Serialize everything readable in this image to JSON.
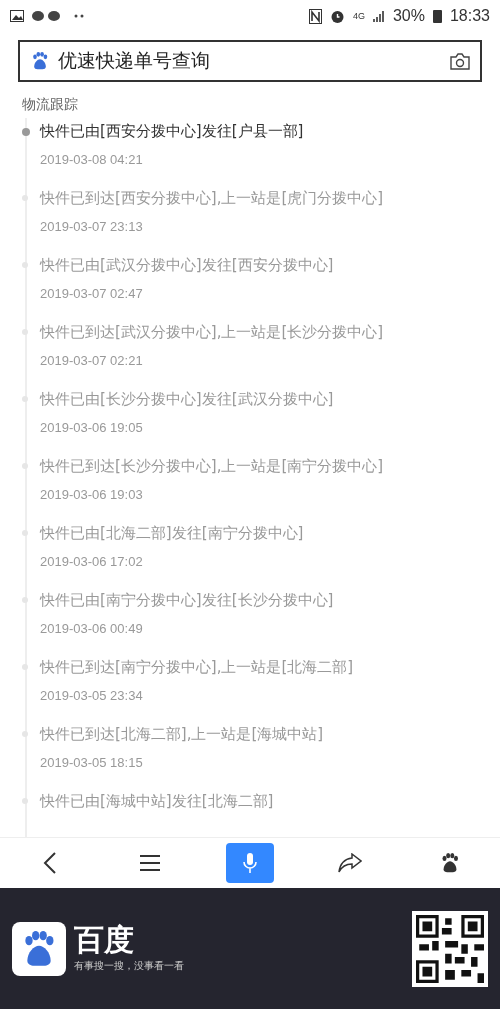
{
  "status_bar": {
    "network": "4G",
    "battery": "30%",
    "time": "18:33"
  },
  "search": {
    "value": "优速快递单号查询"
  },
  "section_title": "物流跟踪",
  "events": [
    {
      "text": "快件已由[西安分拨中心]发往[户县一部]",
      "time": "2019-03-08 04:21",
      "current": true
    },
    {
      "text": "快件已到达[西安分拨中心],上一站是[虎门分拨中心]",
      "time": "2019-03-07 23:13",
      "current": false
    },
    {
      "text": "快件已由[武汉分拨中心]发往[西安分拨中心]",
      "time": "2019-03-07 02:47",
      "current": false
    },
    {
      "text": "快件已到达[武汉分拨中心],上一站是[长沙分拨中心]",
      "time": "2019-03-07 02:21",
      "current": false
    },
    {
      "text": "快件已由[长沙分拨中心]发往[武汉分拨中心]",
      "time": "2019-03-06 19:05",
      "current": false
    },
    {
      "text": "快件已到达[长沙分拨中心],上一站是[南宁分拨中心]",
      "time": "2019-03-06 19:03",
      "current": false
    },
    {
      "text": "快件已由[北海二部]发往[南宁分拨中心]",
      "time": "2019-03-06 17:02",
      "current": false
    },
    {
      "text": "快件已由[南宁分拨中心]发往[长沙分拨中心]",
      "time": "2019-03-06 00:49",
      "current": false
    },
    {
      "text": "快件已到达[南宁分拨中心],上一站是[北海二部]",
      "time": "2019-03-05 23:34",
      "current": false
    },
    {
      "text": "快件已到达[北海二部],上一站是[海城中站]",
      "time": "2019-03-05 18:15",
      "current": false
    },
    {
      "text": "快件已由[海城中站]发往[北海二部]",
      "current": false
    }
  ],
  "toolbar": [
    {
      "kind": "back",
      "selected": false
    },
    {
      "kind": "menu",
      "selected": false
    },
    {
      "kind": "voice",
      "selected": true
    },
    {
      "kind": "share",
      "selected": false
    },
    {
      "kind": "paw",
      "selected": false
    }
  ],
  "footer": {
    "brand": "百度",
    "slogan": "有事搜一搜，没事看一看"
  }
}
